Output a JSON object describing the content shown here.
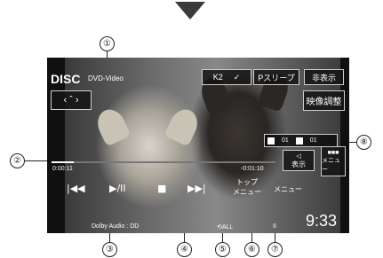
{
  "disc_label": "DISC",
  "source": "DVD-Video",
  "buttons": {
    "k2": "K2",
    "psleep": "Pスリープ",
    "hide": "非表示",
    "picture_adjust": "映像調整",
    "top_menu": "トップ\nメニュー",
    "menu": "メニュー",
    "display": "表示",
    "menu_right": "メニュー"
  },
  "playback": {
    "elapsed": "0:00:11",
    "remaining": "-0:01:10",
    "progress_fraction": 0.1,
    "audio": "Dolby Audio : DD",
    "repeat": "ALL",
    "pause_mark": "II"
  },
  "chapter_info": {
    "title_value": "01",
    "chapter_value": "01"
  },
  "clock": "9:33",
  "callouts": [
    "①",
    "②",
    "③",
    "④",
    "⑤",
    "⑥",
    "⑦",
    "⑧"
  ]
}
